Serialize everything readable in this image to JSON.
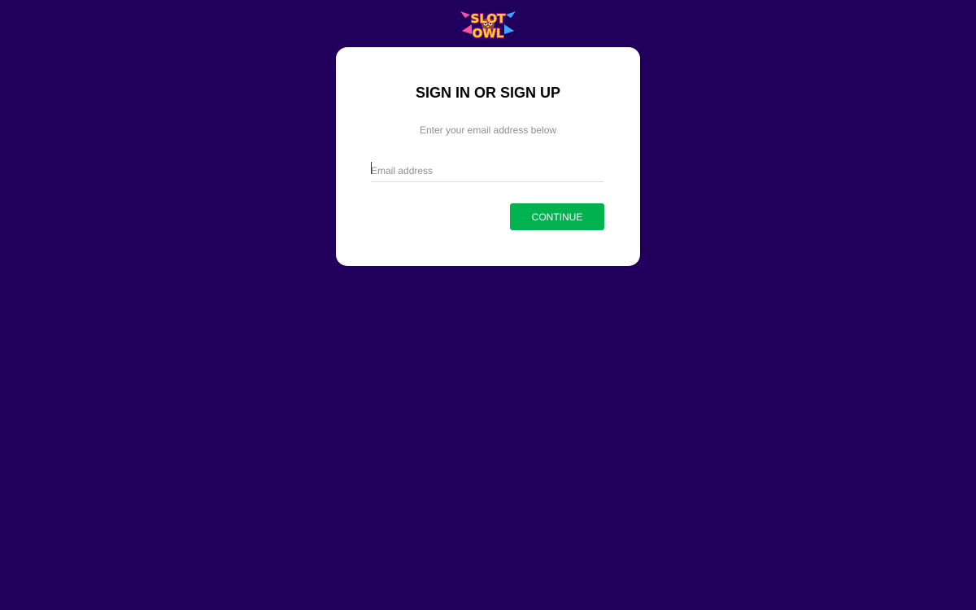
{
  "logo": {
    "line1": "SLOT",
    "line2": "OWL"
  },
  "login_card": {
    "title": "SIGN IN OR SIGN UP",
    "subtitle": "Enter your email address below",
    "email_placeholder": "Email address",
    "email_value": "",
    "continue_label": "CONTINUE"
  },
  "colors": {
    "background": "#21005d",
    "card": "#ffffff",
    "button": "#00b34e",
    "logo_yellow": "#ffd21f",
    "logo_pink": "#ff4fa3",
    "logo_blue": "#3da5ff"
  }
}
